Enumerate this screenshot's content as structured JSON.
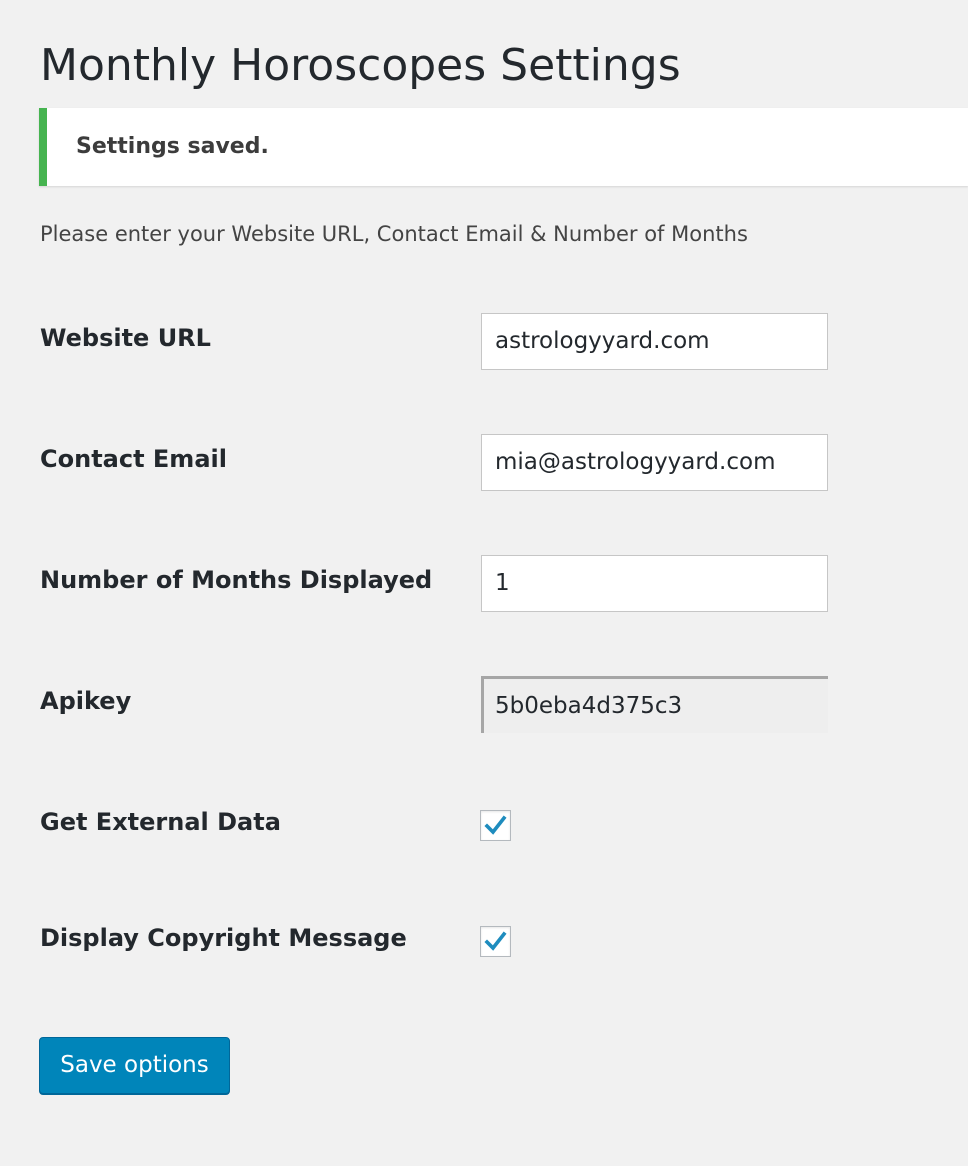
{
  "page": {
    "title": "Monthly Horoscopes Settings"
  },
  "notice": {
    "message": "Settings saved.",
    "accent_color": "#46b450"
  },
  "intro_text": "Please enter your Website URL, Contact Email & Number of Months",
  "form": {
    "website_url": {
      "label": "Website URL",
      "value": "astrologyyard.com"
    },
    "contact_email": {
      "label": "Contact Email",
      "value": "mia@astrologyyard.com"
    },
    "months_displayed": {
      "label": "Number of Months Displayed",
      "value": "1"
    },
    "apikey": {
      "label": "Apikey",
      "value": "5b0eba4d375c3",
      "readonly": true
    },
    "get_external_data": {
      "label": "Get External Data",
      "checked": true,
      "icon": "checkmark-icon"
    },
    "display_copyright": {
      "label": "Display Copyright Message",
      "checked": true,
      "icon": "checkmark-icon"
    }
  },
  "save_button": {
    "label": "Save options",
    "color": "#0085ba"
  },
  "colors": {
    "background": "#f1f1f1",
    "checkmark": "#1e8cbe"
  }
}
